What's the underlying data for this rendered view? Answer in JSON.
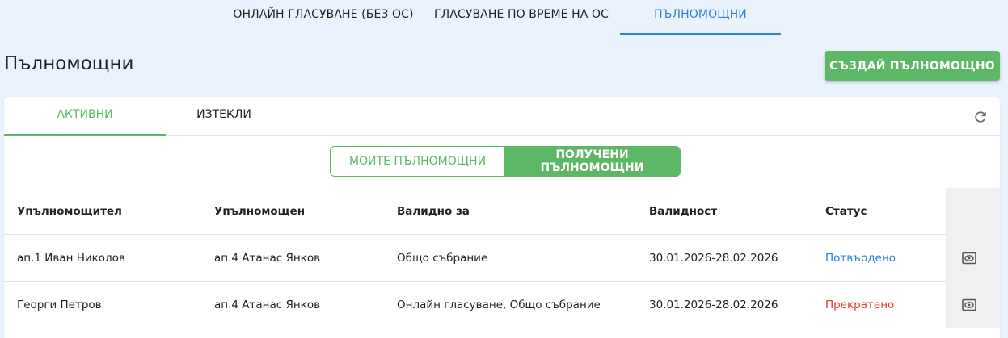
{
  "top_tabs": [
    {
      "label": "ОНЛАЙН ГЛАСУВАНЕ (БЕЗ ОС)",
      "active": false
    },
    {
      "label": "ГЛАСУВАНЕ ПО ВРЕМЕ НА ОС",
      "active": false
    },
    {
      "label": "ПЪЛНОМОЩНИ",
      "active": true
    }
  ],
  "page": {
    "title": "Пълномощни",
    "create_button": "СЪЗДАЙ ПЪЛНОМОЩНО"
  },
  "sub_tabs": [
    {
      "label": "АКТИВНИ",
      "active": true
    },
    {
      "label": "ИЗТЕКЛИ",
      "active": false
    }
  ],
  "toggle": {
    "mine": "МОИТЕ ПЪЛНОМОЩНИ",
    "received": "ПОЛУЧЕНИ ПЪЛНОМОЩНИ",
    "selected": "received"
  },
  "table": {
    "columns": [
      "Упълномощител",
      "Упълномощен",
      "Валидно за",
      "Валидност",
      "Статус"
    ],
    "rows": [
      {
        "principal": "ап.1 Иван Николов",
        "proxy": "ап.4 Атанас Янков",
        "valid_for": "Общо събрание",
        "validity": "30.01.2026-28.02.2026",
        "status": "Потвърдено"
      },
      {
        "principal": "Георги Петров",
        "proxy": "ап.4 Атанас Янков",
        "valid_for": "Онлайн гласуване, Общо събрание",
        "validity": "30.01.2026-28.02.2026",
        "status": "Прекратено"
      }
    ]
  },
  "icons": {
    "refresh": "refresh-icon",
    "view": "eye-icon"
  },
  "colors": {
    "accent_blue": "#2f80d8",
    "accent_green": "#5cb867",
    "status_confirmed": "#2f80d8",
    "status_terminated": "#e53935",
    "background": "#eaf3fd"
  }
}
